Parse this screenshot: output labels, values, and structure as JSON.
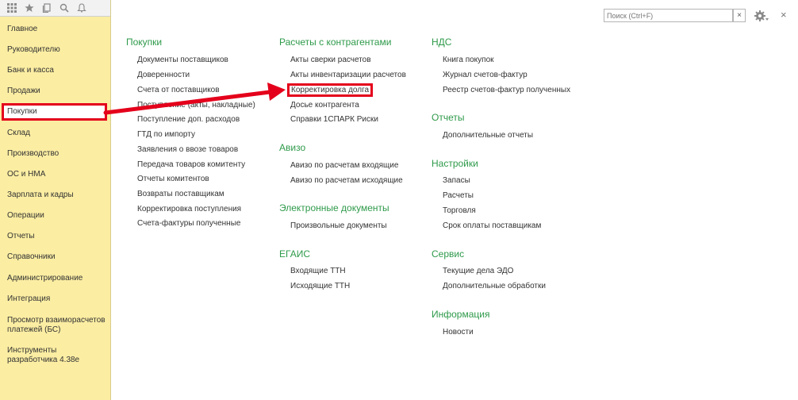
{
  "sidebar": {
    "items": [
      {
        "label": "Главное"
      },
      {
        "label": "Руководителю"
      },
      {
        "label": "Банк и касса"
      },
      {
        "label": "Продажи"
      },
      {
        "label": "Покупки"
      },
      {
        "label": "Склад"
      },
      {
        "label": "Производство"
      },
      {
        "label": "ОС и НМА"
      },
      {
        "label": "Зарплата и кадры"
      },
      {
        "label": "Операции"
      },
      {
        "label": "Отчеты"
      },
      {
        "label": "Справочники"
      },
      {
        "label": "Администрирование"
      },
      {
        "label": "Интеграция"
      },
      {
        "label": "Просмотр взаиморасчетов"
      },
      {
        "label": "платежей (БС)"
      },
      {
        "label": "Инструменты"
      },
      {
        "label": "разработчика 4.38е"
      }
    ],
    "active_label": "Покупки"
  },
  "toolbar": {
    "icons": [
      "apps-grid-icon",
      "star-icon",
      "history-icon",
      "search-icon",
      "bell-icon"
    ]
  },
  "search": {
    "placeholder": "Поиск (Ctrl+F)",
    "clear_label": "×"
  },
  "window": {
    "close_label": "×"
  },
  "col1": {
    "title": "Покупки",
    "links": [
      "Документы поставщиков",
      "Доверенности",
      "Счета от поставщиков",
      "Поступление (акты, накладные)",
      "Поступление доп. расходов",
      "ГТД по импорту",
      "Заявления о ввозе товаров",
      "Передача товаров комитенту",
      "Отчеты комитентов",
      "Возвраты поставщикам",
      "Корректировка поступления",
      "Счета-фактуры полученные"
    ]
  },
  "col2": {
    "groups": [
      {
        "title": "Расчеты с контрагентами",
        "links": [
          "Акты сверки расчетов",
          "Акты инвентаризации расчетов",
          "Корректировка долга",
          "Досье контрагента",
          "Справки 1СПАРК Риски"
        ]
      },
      {
        "title": "Авизо",
        "links": [
          "Авизо по расчетам входящие",
          "Авизо по расчетам исходящие"
        ]
      },
      {
        "title": "Электронные документы",
        "links": [
          "Произвольные документы"
        ]
      },
      {
        "title": "ЕГАИС",
        "links": [
          "Входящие ТТН",
          "Исходящие ТТН"
        ]
      }
    ]
  },
  "col3": {
    "groups": [
      {
        "title": "НДС",
        "links": [
          "Книга покупок",
          "Журнал счетов-фактур",
          "Реестр счетов-фактур полученных"
        ]
      },
      {
        "title": "Отчеты",
        "links": [
          "Дополнительные отчеты"
        ]
      },
      {
        "title": "Настройки",
        "links": [
          "Запасы",
          "Расчеты",
          "Торговля",
          "Срок оплаты поставщикам"
        ]
      },
      {
        "title": "Сервис",
        "links": [
          "Текущие дела ЭДО",
          "Дополнительные обработки"
        ]
      },
      {
        "title": "Информация",
        "links": [
          "Новости"
        ]
      }
    ]
  },
  "colors": {
    "sidebar_bg": "#fbeda2",
    "group_title": "#2e9a4a",
    "highlight": "#e4001b"
  }
}
